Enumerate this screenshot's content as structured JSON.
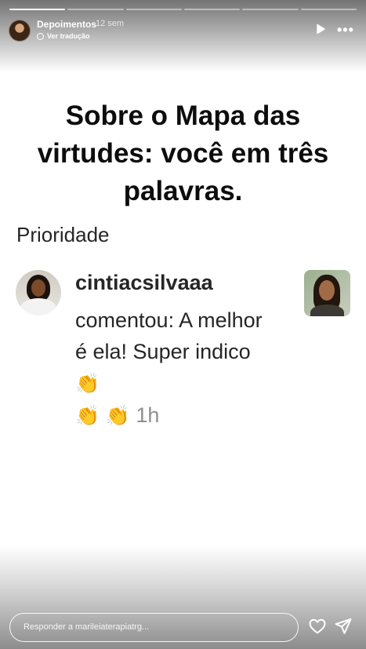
{
  "progress": {
    "segments": 6,
    "completed": 1
  },
  "header": {
    "username": "Depoimentos",
    "time_ago": "12 sem",
    "translate_label": "Ver tradução"
  },
  "story": {
    "title": "Sobre o Mapa das virtudes: você em três palavras.",
    "section_label": "Prioridade",
    "comment": {
      "author": "cintiacsilvaaa",
      "text": "comentou: A melhor é ela! Super indico",
      "emoji": "👏",
      "time": "1h"
    }
  },
  "footer": {
    "reply_placeholder": "Responder a marileiaterapiatrg..."
  },
  "colors": {
    "text_dark": "#0d0d0d",
    "comment_text": "#262626",
    "muted": "#8e8e8e"
  },
  "icons": [
    "play-icon",
    "more-icon",
    "globe-icon",
    "heart-icon",
    "send-icon",
    "clap-emoji"
  ]
}
